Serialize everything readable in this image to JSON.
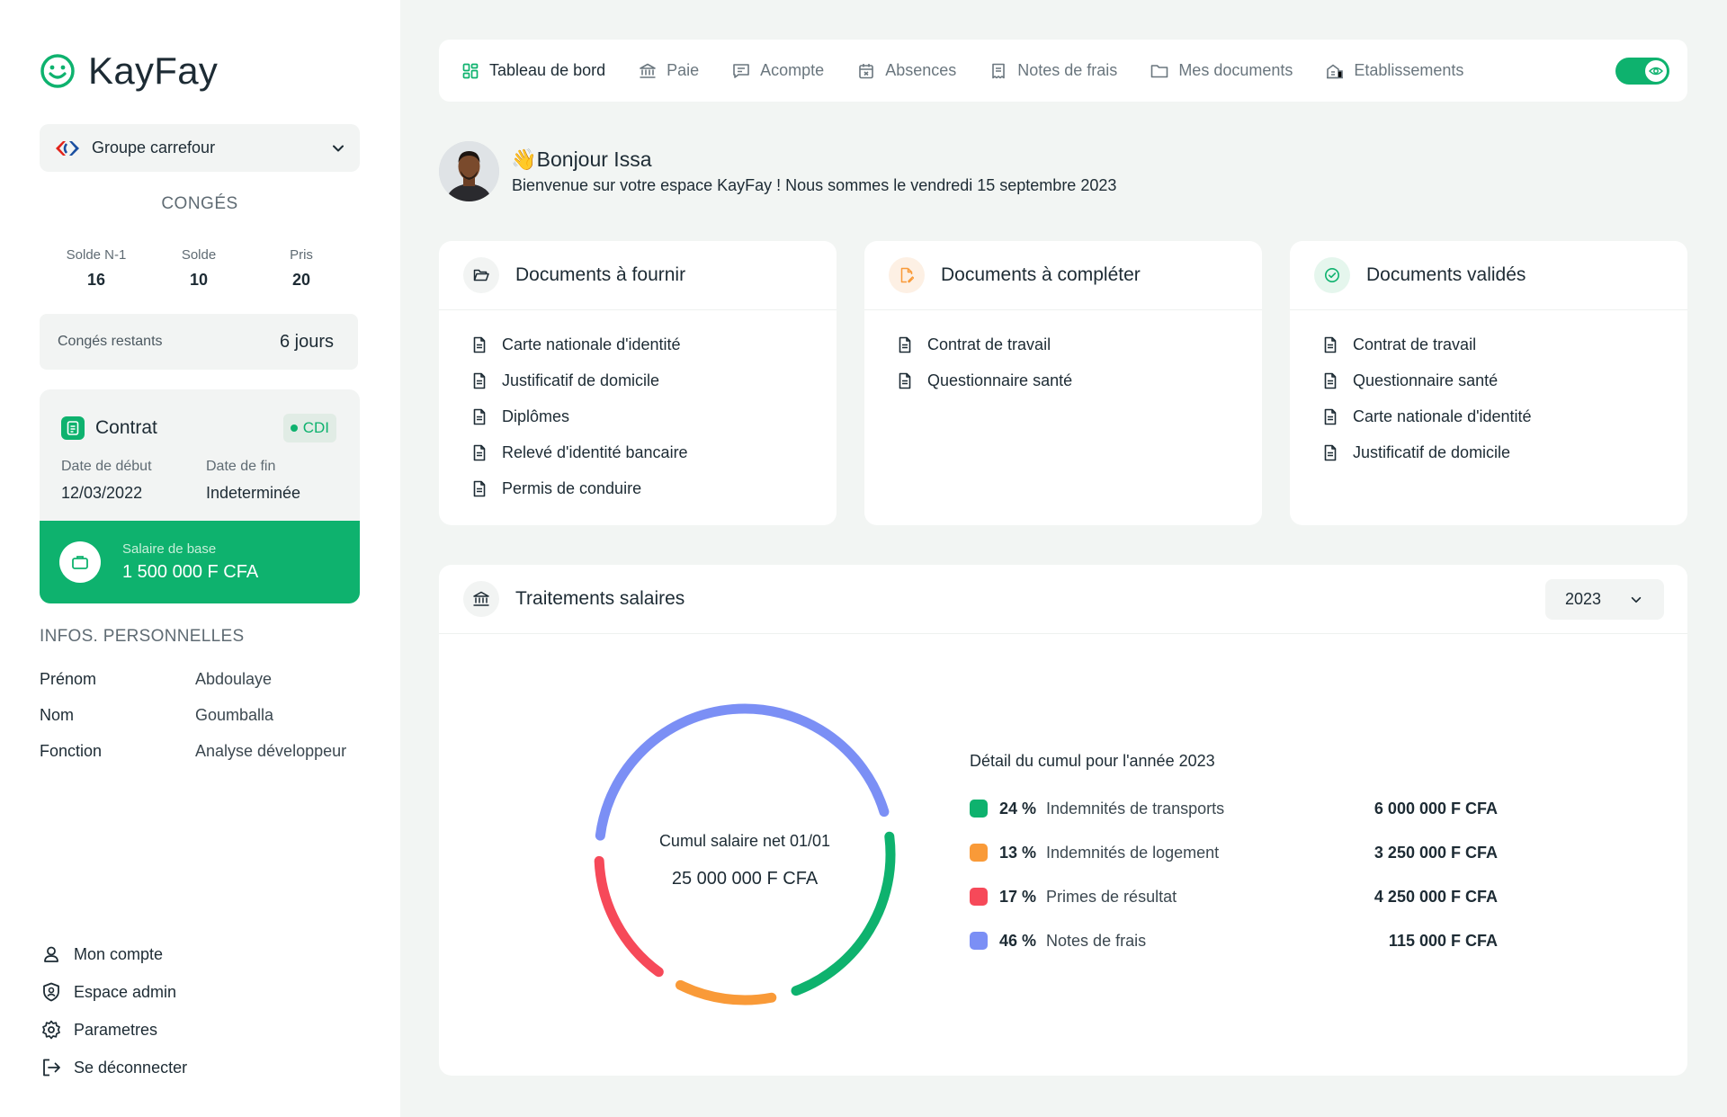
{
  "brand": {
    "name": "KayFay",
    "accent": "#0eb26e"
  },
  "company": {
    "name": "Groupe carrefour",
    "icon": "carrefour-logo"
  },
  "conges": {
    "title": "CONGÉS",
    "columns": [
      {
        "label": "Solde N-1",
        "value": "16"
      },
      {
        "label": "Solde",
        "value": "10"
      },
      {
        "label": "Pris",
        "value": "20"
      }
    ],
    "remaining_label": "Congés restants",
    "remaining_value": "6 jours"
  },
  "contract": {
    "title": "Contrat",
    "badge": "CDI",
    "start_label": "Date de début",
    "start_value": "12/03/2022",
    "end_label": "Date de fin",
    "end_value": "Indeterminée",
    "salary_label": "Salaire de base",
    "salary_value": "1 500 000 F CFA"
  },
  "infos": {
    "title": "INFOS. PERSONNELLES",
    "rows": [
      {
        "key": "Prénom",
        "value": "Abdoulaye"
      },
      {
        "key": "Nom",
        "value": "Goumballa"
      },
      {
        "key": "Fonction",
        "value": "Analyse développeur"
      }
    ]
  },
  "bottom_menu": [
    {
      "label": "Mon compte",
      "icon": "user-icon"
    },
    {
      "label": "Espace admin",
      "icon": "shield-user-icon"
    },
    {
      "label": "Parametres",
      "icon": "gear-icon"
    },
    {
      "label": "Se déconnecter",
      "icon": "logout-icon"
    }
  ],
  "nav": [
    {
      "label": "Tableau de bord",
      "icon": "dashboard-icon",
      "active": true
    },
    {
      "label": "Paie",
      "icon": "bank-icon"
    },
    {
      "label": "Acompte",
      "icon": "message-icon"
    },
    {
      "label": "Absences",
      "icon": "calendar-icon"
    },
    {
      "label": "Notes de frais",
      "icon": "receipt-icon"
    },
    {
      "label": "Mes documents",
      "icon": "folder-icon"
    },
    {
      "label": "Etablissements",
      "icon": "building-icon"
    }
  ],
  "greeting": {
    "emoji": "👋",
    "title": "Bonjour Issa",
    "subtitle": "Bienvenue sur votre espace KayFay ! Nous sommes le vendredi 15 septembre 2023"
  },
  "doc_cards": [
    {
      "title": "Documents à fournir",
      "icon": "folder-open-icon",
      "items": [
        "Carte nationale d'identité",
        "Justificatif de domicile",
        "Diplômes",
        "Relevé d'identité bancaire",
        "Permis de conduire"
      ]
    },
    {
      "title": "Documents à compléter",
      "icon": "file-edit-icon",
      "items": [
        "Contrat de travail",
        "Questionnaire santé"
      ]
    },
    {
      "title": "Documents validés",
      "icon": "check-circle-icon",
      "items": [
        "Contrat de travail",
        "Questionnaire santé",
        "Carte nationale d'identité",
        "Justificatif de domicile"
      ]
    }
  ],
  "salary_panel": {
    "title": "Traitements salaires",
    "year": "2023",
    "donut_label": "Cumul salaire net 01/01",
    "donut_value": "25 000 000 F CFA",
    "legend_title": "Détail du cumul pour l'année 2023",
    "segments": [
      {
        "pct": "24 %",
        "name": "Indemnités de transports",
        "amount": "6 000 000 F CFA",
        "color": "#0eb26e",
        "share": 24
      },
      {
        "pct": "13 %",
        "name": "Indemnités de logement",
        "amount": "3 250 000 F CFA",
        "color": "#f99a38",
        "share": 13
      },
      {
        "pct": "17 %",
        "name": "Primes de résultat",
        "amount": "4 250 000 F CFA",
        "color": "#f64959",
        "share": 17
      },
      {
        "pct": "46 %",
        "name": "Notes de frais",
        "amount": "115 000 F CFA",
        "color": "#7b8ff5",
        "share": 46
      }
    ]
  }
}
